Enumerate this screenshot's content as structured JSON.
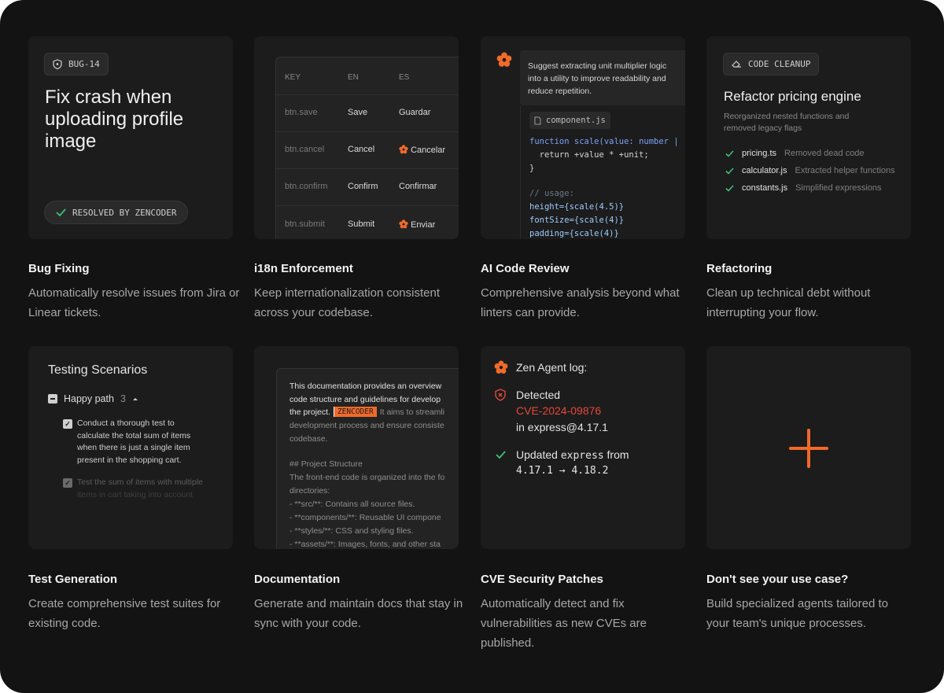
{
  "colors": {
    "background": "#131313",
    "card": "#1c1c1c",
    "accent": "#f06a2a",
    "check": "#3fbf77",
    "danger": "#e5483b"
  },
  "cards": [
    {
      "title": "Bug Fixing",
      "description": "Automatically resolve issues from Jira or Linear tickets.",
      "badge": "BUG-14",
      "heading": "Fix crash when uploading profile image",
      "status": "RESOLVED BY ZENCODER"
    },
    {
      "title": "i18n Enforcement",
      "description": "Keep internationalization consistent across your codebase.",
      "headers": [
        "KEY",
        "EN",
        "ES"
      ],
      "rows": [
        {
          "key": "btn.save",
          "en": "Save",
          "es": "Guardar"
        },
        {
          "key": "btn.cancel",
          "en": "Cancel",
          "es": "Cancelar"
        },
        {
          "key": "btn.confirm",
          "en": "Confirm",
          "es": "Confirmar"
        },
        {
          "key": "btn.submit",
          "en": "Submit",
          "es": "Enviar"
        }
      ]
    },
    {
      "title": "AI Code Review",
      "description": "Comprehensive analysis beyond what linters can provide.",
      "suggestion": [
        "Suggest extracting unit multiplier logic",
        "into a utility to improve readability and",
        "reduce repetition."
      ],
      "file": "component.js",
      "code": {
        "l1": "function scale(value: number |",
        "l2": "  return +value * +unit;",
        "l3": "}",
        "l4": "// usage:",
        "l5": "height={scale(4.5)}",
        "l6": "fontSize={scale(4)}",
        "l7": "padding={scale(4)}"
      }
    },
    {
      "title": "Refactoring",
      "description": "Clean up technical debt without interrupting your flow.",
      "badge": "CODE CLEANUP",
      "heading": "Refactor pricing engine",
      "subheading": [
        "Reorganized nested functions and",
        "removed legacy flags"
      ],
      "changes": [
        {
          "file": "pricing.ts",
          "note": "Removed dead code"
        },
        {
          "file": "calculator.js",
          "note": "Extracted helper functions"
        },
        {
          "file": "constants.js",
          "note": "Simplified expressions"
        }
      ]
    },
    {
      "title": "Test Generation",
      "description": "Create comprehensive test suites for existing code.",
      "heading": "Testing Scenarios",
      "group_label": "Happy path",
      "group_count": "3",
      "tests": [
        [
          "Conduct a thorough test to",
          "calculate the total sum of items",
          "when there is just a single item",
          "present in the shopping cart."
        ],
        [
          "Test the sum of items with multiple",
          "items in cart taking into account"
        ]
      ]
    },
    {
      "title": "Documentation",
      "description": "Generate and maintain docs that stay in sync with your code.",
      "lines": {
        "l1": "This documentation provides an overview",
        "l2": "code structure and guidelines for develop",
        "l3a": "the project.",
        "tag": "ZENCODER",
        "l3b": "It aims to streamli",
        "l4": "development process and ensure consiste",
        "l5": "codebase.",
        "l6": "## Project Structure",
        "l7": "The front-end code is organized into the fo",
        "l8": "directories:",
        "l9": "- **src/**: Contains all source files.",
        "l10": "- **components/**: Reusable UI compone",
        "l11": "- **styles/**: CSS and styling files.",
        "l12": "- **assets/**: Images, fonts, and other sta"
      }
    },
    {
      "title": "CVE Security Patches",
      "description": "Automatically detect and fix vulnerabilities as new CVEs are published.",
      "log_title": "Zen Agent log:",
      "detected": "Detected",
      "cve": "CVE-2024-09876",
      "package": "in express@4.17.1",
      "updated_prefix": "Updated",
      "updated_pkg": "express",
      "updated_suffix": "from",
      "versions": "4.17.1 → 4.18.2"
    },
    {
      "title": "Don't see your use case?",
      "description": "Build specialized agents tailored to your team's unique processes."
    }
  ],
  "icons": {
    "plus": "plus-icon",
    "check": "check-icon",
    "shield": "shield-icon",
    "flower": "zen-logo-icon"
  }
}
